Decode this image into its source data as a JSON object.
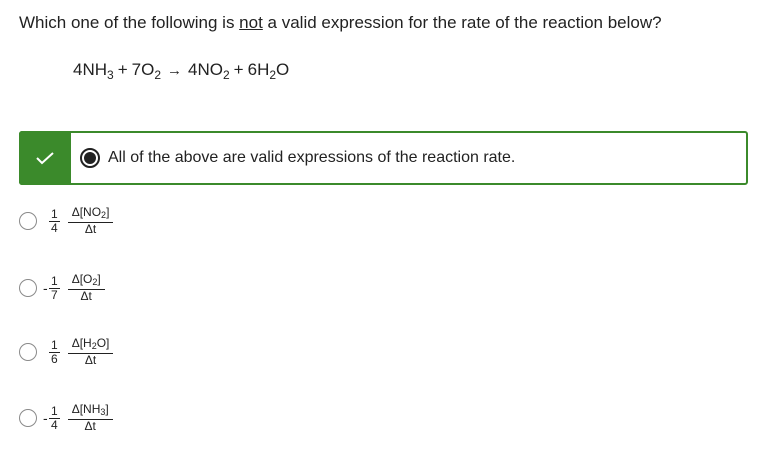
{
  "question": {
    "before": "Which one of the following is ",
    "underlined": "not",
    "after": " a valid expression for the rate of the reaction below?"
  },
  "equation": {
    "term1": "4NH",
    "term1_sub": "3",
    "plus1": "+",
    "term2": "7O",
    "term2_sub": "2",
    "arrow": "→",
    "term3": "4NO",
    "term3_sub": "2",
    "plus2": "+",
    "term4": "6H",
    "term4_sub": "2",
    "term4_tail": "O"
  },
  "correct_answer": {
    "text": "All of the above are valid expressions of the reaction rate.",
    "accent_color": "#3b8a2b"
  },
  "options": [
    {
      "sign": "",
      "coef_num": "1",
      "coef_den": "4",
      "delta_pre": "Δ[NO",
      "delta_sub": "2",
      "delta_post": "]",
      "den": "Δt"
    },
    {
      "sign": "-",
      "coef_num": "1",
      "coef_den": "7",
      "delta_pre": "Δ[O",
      "delta_sub": "2",
      "delta_post": "]",
      "den": "Δt"
    },
    {
      "sign": "",
      "coef_num": "1",
      "coef_den": "6",
      "delta_pre": "Δ[H",
      "delta_sub": "2",
      "delta_post": "O]",
      "den": "Δt"
    },
    {
      "sign": "-",
      "coef_num": "1",
      "coef_den": "4",
      "delta_pre": "Δ[NH",
      "delta_sub": "3",
      "delta_post": "]",
      "den": "Δt"
    }
  ]
}
